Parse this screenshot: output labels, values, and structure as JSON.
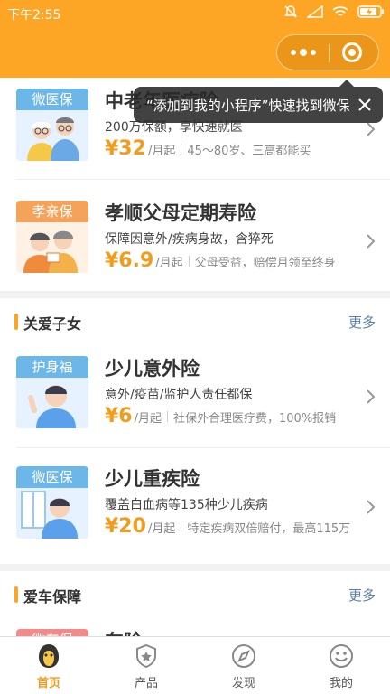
{
  "status_bar": {
    "time": "下午2:55"
  },
  "tooltip": {
    "text": "“添加到我的小程序”快速找到微保"
  },
  "colors": {
    "brand": "#fda626",
    "price": "#f29c1f",
    "badge_blue": "#6cb6e8",
    "badge_orange": "#f5a35b",
    "more_link": "#5c7fa6"
  },
  "section_elders": {
    "items": [
      {
        "badge": "微医保",
        "title": "中老年医疗险",
        "desc": "200万保额，享快速就医",
        "price": "¥32",
        "unit": "/月起",
        "note": "45～80岁、三高都能买",
        "icon": "elderly-couple-icon"
      },
      {
        "badge": "孝亲保",
        "title": "孝顺父母定期寿险",
        "desc": "保障因意外/疾病身故，含猝死",
        "price": "¥6.9",
        "unit": "/月起",
        "note": "父母受益，赔偿月领至终身",
        "icon": "parents-with-card-icon"
      }
    ]
  },
  "section_children": {
    "title": "关爱子女",
    "more": "更多",
    "items": [
      {
        "badge": "护身福",
        "title": "少儿意外险",
        "desc": "意外/疫苗/监护人责任都保",
        "price": "¥6",
        "unit": "/月起",
        "note": "社保外合理医疗费，100%报销",
        "icon": "boy-waving-icon"
      },
      {
        "badge": "微医保",
        "title": "少儿重疾险",
        "desc": "覆盖白血病等135种少儿疾病",
        "price": "¥20",
        "unit": "/月起",
        "note": "特定疾病双倍赔付，最高115万",
        "icon": "boy-at-window-icon"
      }
    ]
  },
  "section_car": {
    "title": "爱车保障",
    "more": "更多",
    "items": [
      {
        "badge": "微车保",
        "title": "车险"
      }
    ]
  },
  "tabbar": {
    "tabs": [
      {
        "label": "首页",
        "icon": "home-penguin-icon"
      },
      {
        "label": "产品",
        "icon": "product-shield-icon"
      },
      {
        "label": "发现",
        "icon": "compass-icon"
      },
      {
        "label": "我的",
        "icon": "smiley-icon"
      }
    ]
  }
}
